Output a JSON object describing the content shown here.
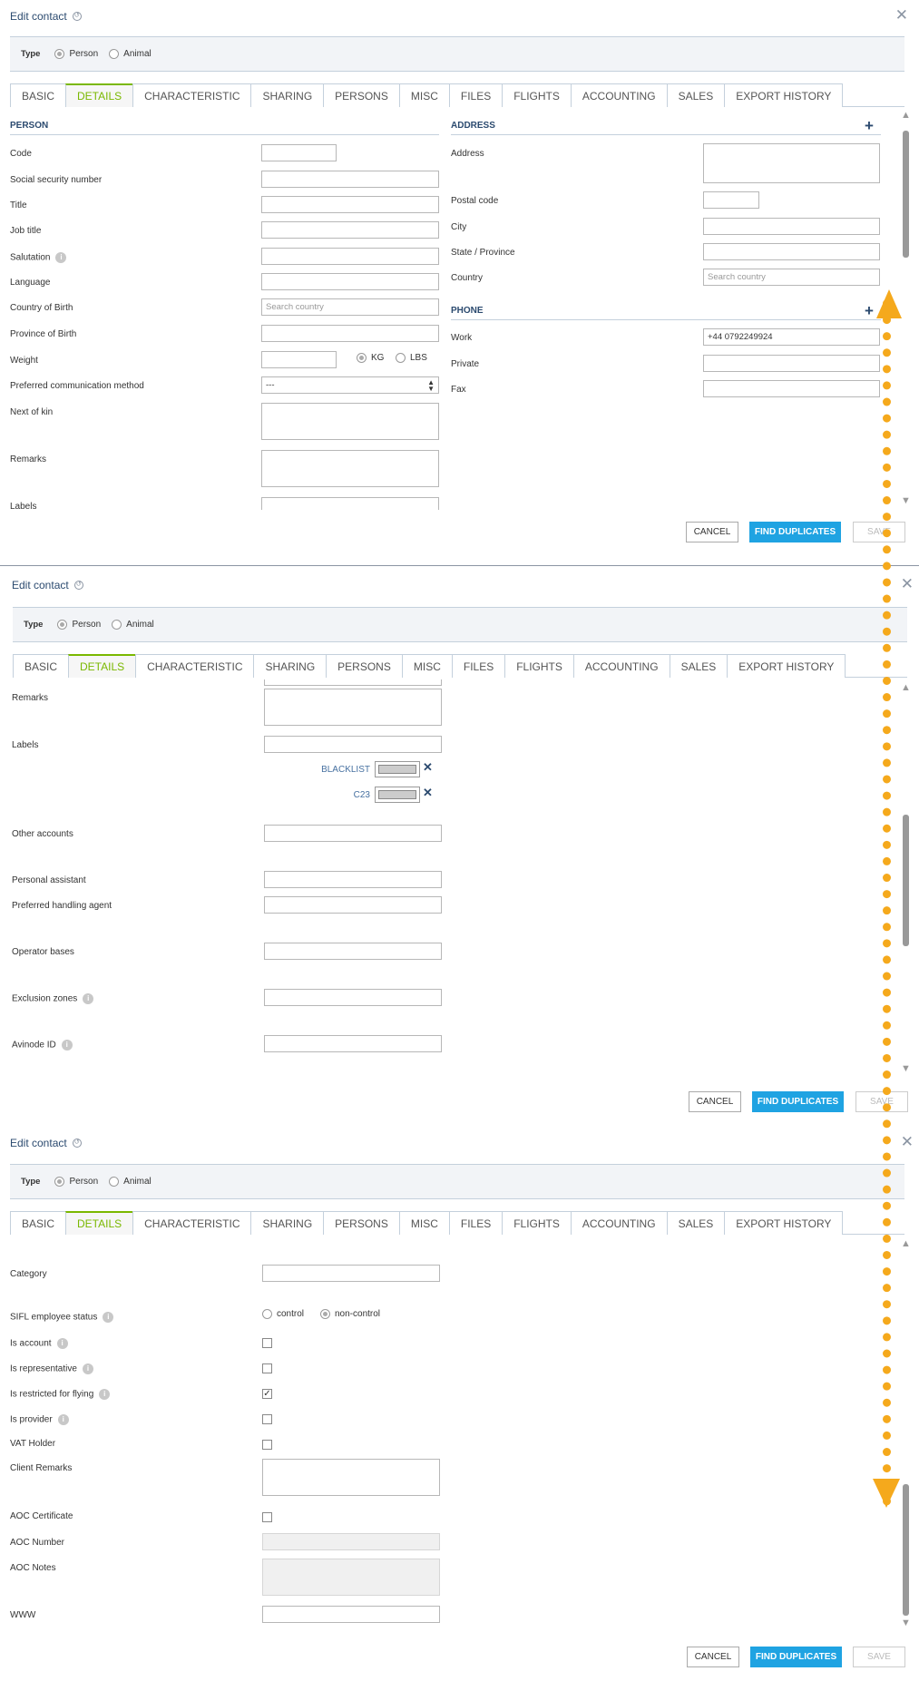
{
  "dialog": {
    "title": "Edit contact",
    "type_label": "Type",
    "type_options": [
      "Person",
      "Animal"
    ],
    "tabs": [
      "BASIC",
      "DETAILS",
      "CHARACTERISTIC",
      "SHARING",
      "PERSONS",
      "MISC",
      "FILES",
      "FLIGHTS",
      "ACCOUNTING",
      "SALES",
      "EXPORT HISTORY"
    ],
    "active_tab": "DETAILS",
    "buttons": {
      "cancel": "CANCEL",
      "find": "FIND DUPLICATES",
      "save": "SAVE"
    }
  },
  "panel1": {
    "person_section": "PERSON",
    "address_section": "ADDRESS",
    "phone_section": "PHONE",
    "fields": {
      "code": "Code",
      "ssn": "Social security number",
      "title": "Title",
      "job_title": "Job title",
      "salutation": "Salutation",
      "language": "Language",
      "country_birth": "Country of Birth",
      "province_birth": "Province of Birth",
      "weight": "Weight",
      "pref_comm": "Preferred communication method",
      "next_kin": "Next of kin",
      "remarks": "Remarks",
      "labels": "Labels"
    },
    "country_birth_placeholder": "Search country",
    "weight_units": [
      "KG",
      "LBS"
    ],
    "pref_comm_value": "---",
    "address": {
      "address": "Address",
      "postal": "Postal code",
      "city": "City",
      "state": "State / Province",
      "country": "Country",
      "country_placeholder": "Search country"
    },
    "phone": {
      "work": "Work",
      "work_value": "+44 0792249924",
      "private": "Private",
      "fax": "Fax"
    }
  },
  "panel2": {
    "remarks": "Remarks",
    "labels": "Labels",
    "label_chips": [
      "BLACKLIST",
      "C23"
    ],
    "other_accounts": "Other accounts",
    "personal_assistant": "Personal assistant",
    "pref_handling": "Preferred handling agent",
    "operator_bases": "Operator bases",
    "exclusion_zones": "Exclusion zones",
    "avinode_id": "Avinode ID"
  },
  "panel3": {
    "category": "Category",
    "sifl": "SIFL employee status",
    "sifl_options": [
      "control",
      "non-control"
    ],
    "is_account": "Is account",
    "is_representative": "Is representative",
    "is_restricted": "Is restricted for flying",
    "is_provider": "Is provider",
    "vat_holder": "VAT Holder",
    "client_remarks": "Client Remarks",
    "aoc_cert": "AOC Certificate",
    "aoc_number": "AOC Number",
    "aoc_notes": "AOC Notes",
    "www": "WWW"
  },
  "colors": {
    "accent_green": "#7ab800",
    "primary_blue": "#1fa3e2",
    "title_blue": "#2b4a6f",
    "annotation_orange": "#f5a91c"
  }
}
